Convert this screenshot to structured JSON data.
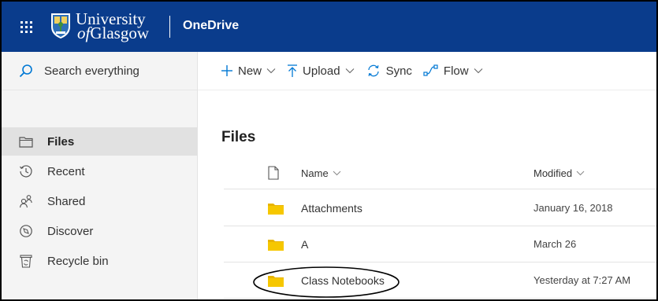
{
  "colors": {
    "suite_bar": "#0a3c8c",
    "nav_background": "#f4f4f4",
    "nav_selected": "#e1e1e1",
    "folder": "#f6c700",
    "accent_blue": "#0078d4"
  },
  "header": {
    "waffle_icon": "waffle-icon",
    "logo_line1": "University",
    "logo_line2_prefix": "of",
    "logo_line2_rest": "Glasgow",
    "app_name": "OneDrive"
  },
  "search": {
    "icon": "search-icon",
    "placeholder": "Search everything"
  },
  "nav": {
    "items": [
      {
        "label": "Files",
        "icon": "folder-outline-icon",
        "selected": true
      },
      {
        "label": "Recent",
        "icon": "clock-icon",
        "selected": false
      },
      {
        "label": "Shared",
        "icon": "people-icon",
        "selected": false
      },
      {
        "label": "Discover",
        "icon": "compass-icon",
        "selected": false
      },
      {
        "label": "Recycle bin",
        "icon": "recycle-bin-icon",
        "selected": false
      }
    ]
  },
  "commands": {
    "new_label": "New",
    "upload_label": "Upload",
    "sync_label": "Sync",
    "flow_label": "Flow"
  },
  "page": {
    "title": "Files"
  },
  "file_list": {
    "columns": {
      "type_icon": "file-icon",
      "name": "Name",
      "modified": "Modified"
    },
    "rows": [
      {
        "name": "Attachments",
        "modified": "January 16, 2018",
        "icon": "folder-icon"
      },
      {
        "name": "A",
        "modified": "March 26",
        "icon": "folder-icon"
      },
      {
        "name": "Class Notebooks",
        "modified": "Yesterday at 7:27 AM",
        "icon": "folder-icon",
        "annotated": true
      }
    ]
  }
}
